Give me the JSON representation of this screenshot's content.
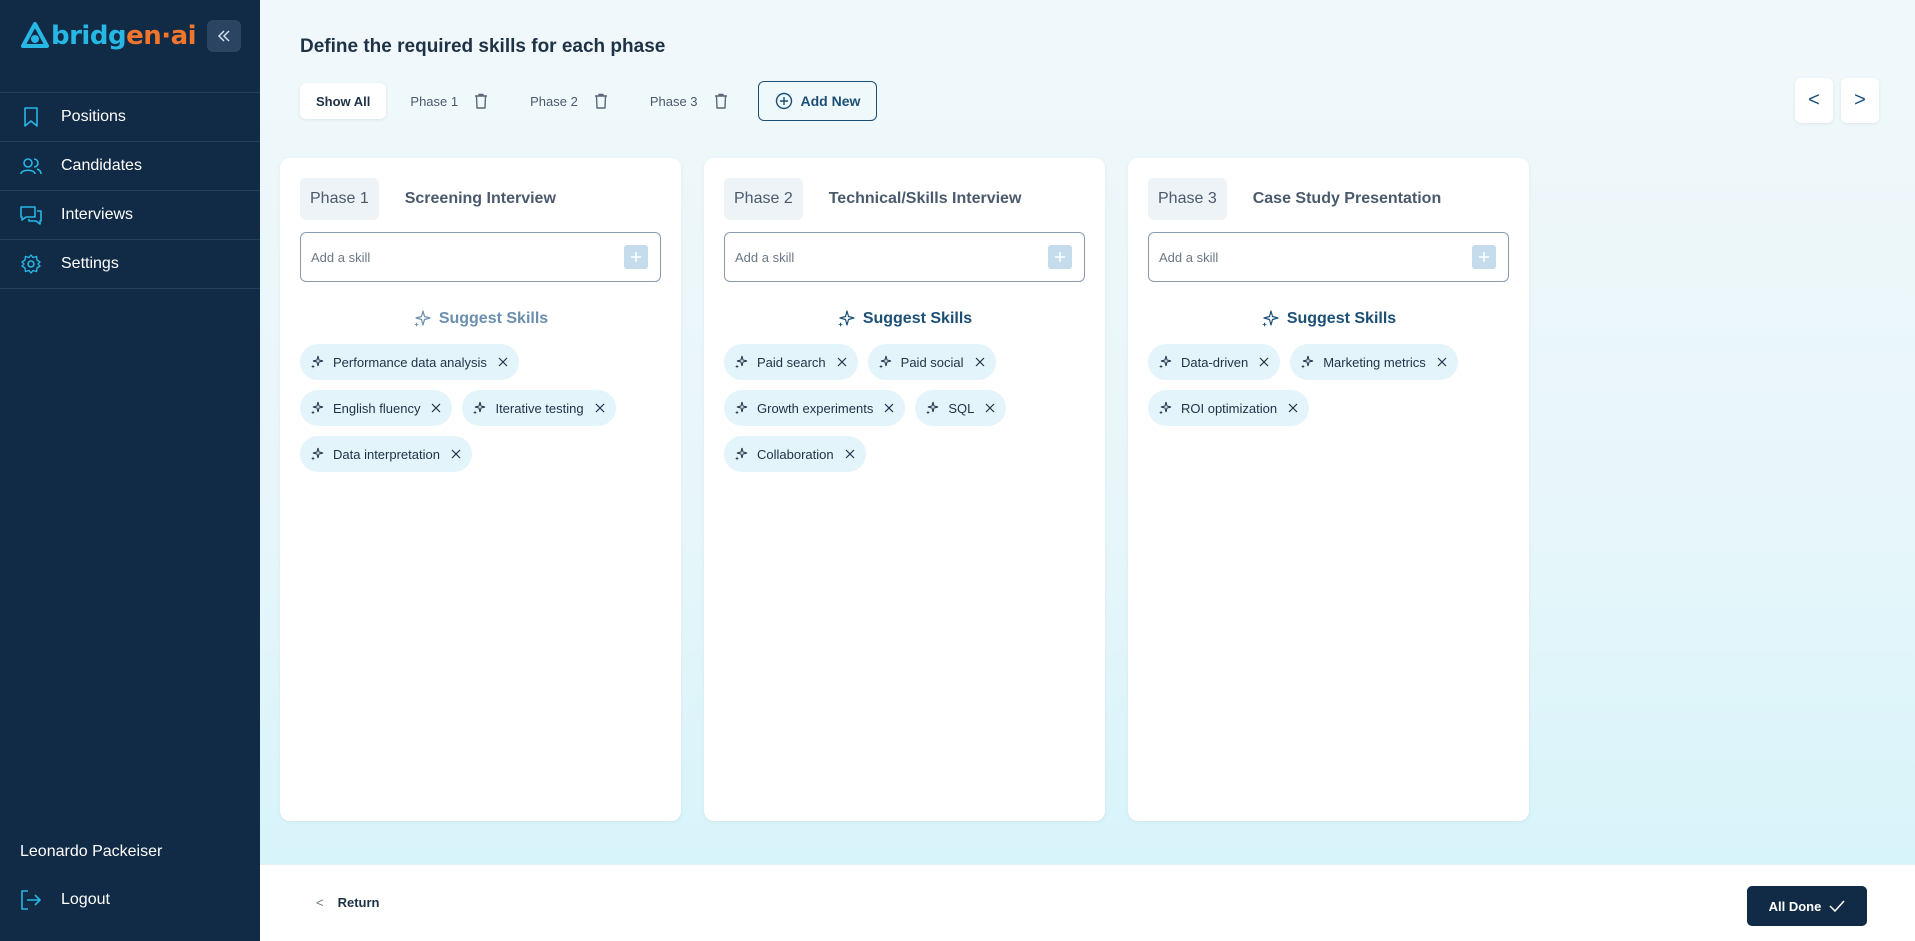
{
  "app": {
    "logo_part1": "bridg",
    "logo_part2": "en·ai"
  },
  "sidebar": {
    "items": [
      {
        "label": "Positions",
        "icon": "bookmark-icon"
      },
      {
        "label": "Candidates",
        "icon": "users-icon"
      },
      {
        "label": "Interviews",
        "icon": "chat-icon"
      },
      {
        "label": "Settings",
        "icon": "gear-icon"
      }
    ],
    "user_name": "Leonardo Packeiser",
    "logout_label": "Logout"
  },
  "header": {
    "title": "Define the required skills for each phase"
  },
  "tabs": {
    "show_all": "Show All",
    "phases": [
      "Phase 1",
      "Phase 2",
      "Phase 3"
    ],
    "add_new": "Add New"
  },
  "pager": {
    "prev": "<",
    "next": ">"
  },
  "cards": [
    {
      "phase": "Phase 1",
      "name": "Screening Interview",
      "input_placeholder": "Add a skill",
      "suggest_label": "Suggest Skills",
      "skills": [
        "Performance data analysis",
        "English fluency",
        "Iterative testing",
        "Data interpretation"
      ]
    },
    {
      "phase": "Phase 2",
      "name": "Technical/Skills Interview",
      "input_placeholder": "Add a skill",
      "suggest_label": "Suggest Skills",
      "skills": [
        "Paid search",
        "Paid social",
        "Growth experiments",
        "SQL",
        "Collaboration"
      ]
    },
    {
      "phase": "Phase 3",
      "name": "Case Study Presentation",
      "input_placeholder": "Add a skill",
      "suggest_label": "Suggest Skills",
      "skills": [
        "Data-driven",
        "Marketing metrics",
        "ROI optimization"
      ]
    }
  ],
  "footer": {
    "return_chevron": "<",
    "return_label": "Return",
    "done_label": "All Done"
  },
  "colors": {
    "sidebar_bg": "#112a45",
    "accent": "#1b4f76",
    "logo_blue": "#27b7e5",
    "logo_orange": "#f0762e",
    "chip_bg": "#e3f4fb"
  }
}
